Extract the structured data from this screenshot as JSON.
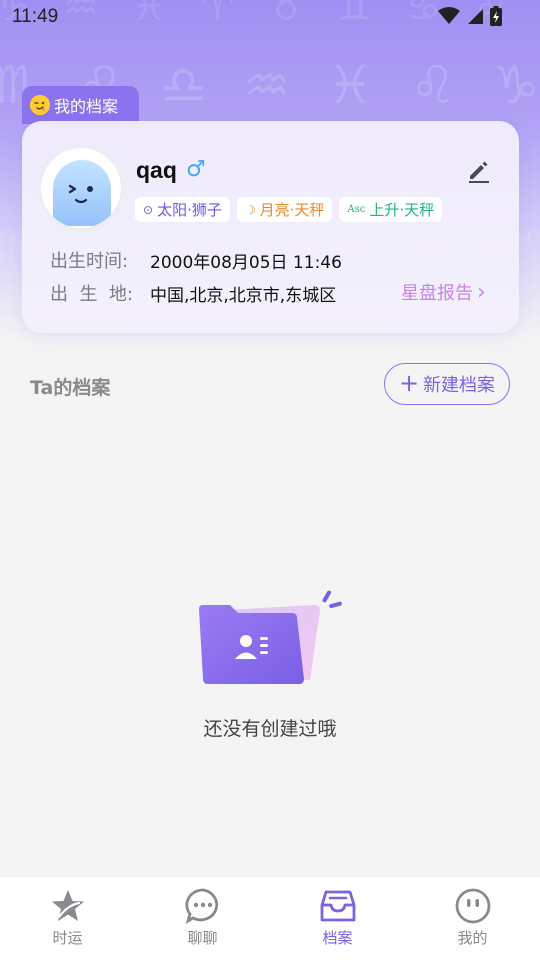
{
  "status_bar": {
    "time": "11:49"
  },
  "background": {
    "zodiac_glyphs": "♈ ♉ ♊ ♋ ♌ ♍ ♎ ♏ ♐ ♑ ♒ ♓",
    "zodiac_row_top": "♑ ♒ ♓ ♈ ♉ ♊ ♋ ♌ ♍",
    "zodiac_row_main": "♏ ♌ ♎ ♒ ♓ ♌ ♑ ♐",
    "zodiac_row_low": "♍ ♎ ♏ ♐ ♑ ♒ ♓ ♈"
  },
  "profile": {
    "tab_label": "我的档案",
    "name": "qaq",
    "gender_symbol": "♂",
    "tags": {
      "sun": {
        "icon": "⊙",
        "label": "太阳·狮子"
      },
      "moon": {
        "icon": "☽",
        "label": "月亮·天秤"
      },
      "asc": {
        "icon": "Asc",
        "label": "上升·天秤"
      }
    },
    "birth_time_label": "出生时间:",
    "birth_time_value": "2000年08月05日 11:46",
    "birth_place_label": "出  生  地:",
    "birth_place_value": "中国,北京,北京市,东城区",
    "chart_report_label": "星盘报告",
    "chart_report_arrow": "›"
  },
  "ta_section": {
    "title": "Ta的档案",
    "new_button_plus": "+",
    "new_button_label": "新建档案"
  },
  "empty_state": {
    "message": "还没有创建过哦"
  },
  "bottom_nav": {
    "items": [
      {
        "label": "时运",
        "icon": "star-fortune-icon"
      },
      {
        "label": "聊聊",
        "icon": "chat-bubble-icon"
      },
      {
        "label": "档案",
        "icon": "archive-tray-icon"
      },
      {
        "label": "我的",
        "icon": "profile-face-icon"
      }
    ],
    "active_index": 2
  },
  "colors": {
    "accent": "#8b73f0",
    "sun_tag": "#6c5ae8",
    "moon_tag": "#f08a27",
    "asc_tag": "#20b585",
    "chart_link": "#c883ec",
    "gender": "#3fa9f5"
  }
}
